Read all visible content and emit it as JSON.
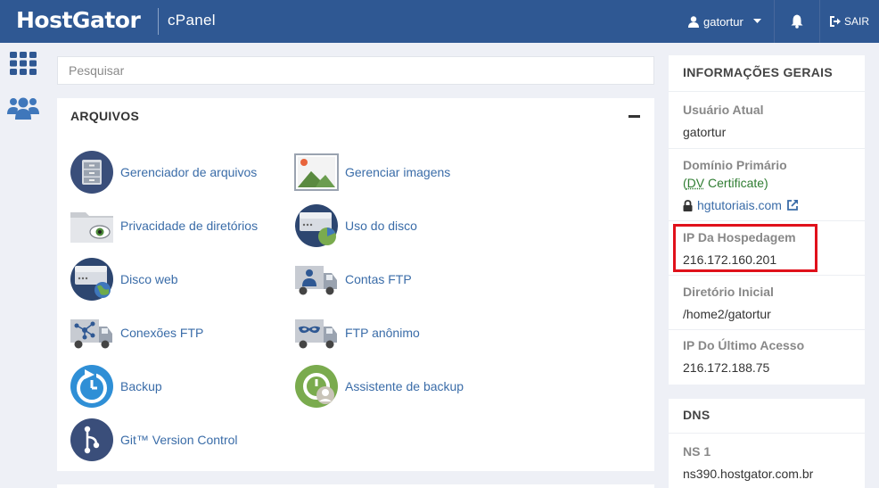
{
  "header": {
    "logo": "HostGator",
    "product": "cPanel",
    "username": "gatortur",
    "logout_label": "SAIR",
    "icons": [
      "user-icon",
      "caret-down-icon",
      "bell-icon",
      "sign-out-icon"
    ]
  },
  "sidebar": {
    "items": [
      {
        "name": "grid-apps-icon",
        "label": "Home"
      },
      {
        "name": "users-icon",
        "label": "Users"
      }
    ]
  },
  "search": {
    "placeholder": "Pesquisar"
  },
  "files_panel": {
    "title": "ARQUIVOS",
    "items": [
      {
        "label": "Gerenciador de arquivos",
        "icon": "file-cabinet-icon"
      },
      {
        "label": "Gerenciar imagens",
        "icon": "image-icon"
      },
      {
        "label": "Privacidade de diretórios",
        "icon": "folder-eye-icon"
      },
      {
        "label": "Uso do disco",
        "icon": "disk-usage-icon"
      },
      {
        "label": "Disco web",
        "icon": "web-disk-icon"
      },
      {
        "label": "Contas FTP",
        "icon": "ftp-accounts-truck-icon"
      },
      {
        "label": "Conexões FTP",
        "icon": "ftp-connections-truck-icon"
      },
      {
        "label": "FTP anônimo",
        "icon": "anonymous-ftp-truck-icon"
      },
      {
        "label": "Backup",
        "icon": "backup-icon"
      },
      {
        "label": "Assistente de backup",
        "icon": "backup-wizard-icon"
      },
      {
        "label": "Git™ Version Control",
        "icon": "git-icon"
      }
    ]
  },
  "general_info": {
    "title": "INFORMAÇÕES GERAIS",
    "current_user_label": "Usuário Atual",
    "current_user_value": "gatortur",
    "primary_domain_label": "Domínio Primário",
    "dv_paren_open": "(",
    "dv_abbr": "DV",
    "dv_rest": " Certificate)",
    "domain_link": "hgtutoriais.com",
    "hosting_ip_label": "IP Da Hospedagem",
    "hosting_ip_value": "216.172.160.201",
    "home_dir_label": "Diretório Inicial",
    "home_dir_value": "/home2/gatortur",
    "last_ip_label": "IP Do Último Acesso",
    "last_ip_value": "216.172.188.75"
  },
  "dns": {
    "title": "DNS",
    "ns1_label": "NS 1",
    "ns1_value": "ns390.hostgator.com.br"
  },
  "colors": {
    "topbar": "#2f5893",
    "link": "#3a6ca8",
    "highlight": "#e0111b",
    "certificate_green": "#2f7d32"
  }
}
